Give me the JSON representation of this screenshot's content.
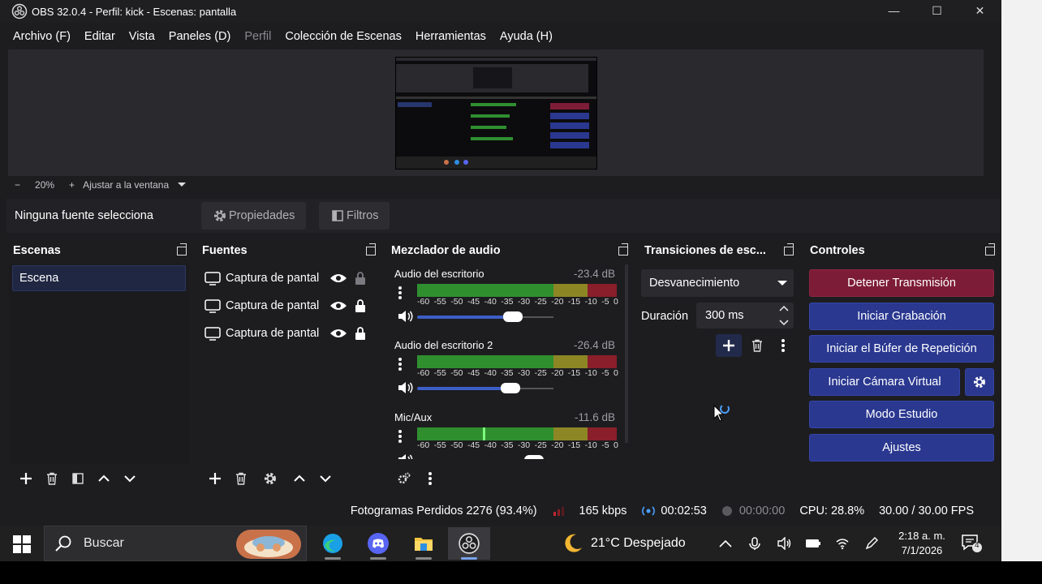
{
  "window": {
    "title": "OBS 32.0.4 - Perfil: kick - Escenas: pantalla",
    "minimize": "—",
    "maximize": "☐",
    "close": "✕"
  },
  "menu": [
    "Archivo (F)",
    "Editar",
    "Vista",
    "Paneles (D)",
    "Perfil",
    "Colección de Escenas",
    "Herramientas",
    "Ayuda (H)"
  ],
  "menu_disabled_index": 4,
  "zoom": {
    "minus": "−",
    "level": "20%",
    "plus": "+",
    "fit_label": "Ajustar a la ventana"
  },
  "context": {
    "no_source": "Ninguna fuente selecciona",
    "properties": "Propiedades",
    "filters": "Filtros"
  },
  "docks": {
    "scenes": {
      "title": "Escenas",
      "items": [
        "Escena"
      ]
    },
    "sources": {
      "title": "Fuentes",
      "items": [
        {
          "name": "Captura de pantal",
          "locked": false
        },
        {
          "name": "Captura de pantal",
          "locked": true
        },
        {
          "name": "Captura de pantal",
          "locked": true
        }
      ]
    },
    "mixer": {
      "title": "Mezclador de audio",
      "channels": [
        {
          "name": "Audio del escritorio",
          "db": "-23.4 dB",
          "volume_fraction": 0.74,
          "peak_fraction": null
        },
        {
          "name": "Audio del escritorio 2",
          "db": "-26.4 dB",
          "volume_fraction": 0.72,
          "peak_fraction": null
        },
        {
          "name": "Mic/Aux",
          "db": "-11.6 dB",
          "volume_fraction": 0.9,
          "peak_fraction": 0.33
        }
      ],
      "scale": [
        "-60",
        "-55",
        "-50",
        "-45",
        "-40",
        "-35",
        "-30",
        "-25",
        "-20",
        "-15",
        "-10",
        "-5",
        "0"
      ]
    },
    "transitions": {
      "title": "Transiciones de esc...",
      "selected": "Desvanecimiento",
      "duration_label": "Duración",
      "duration_value": "300 ms"
    },
    "controls": {
      "title": "Controles",
      "buttons": [
        "Detener Transmisión",
        "Iniciar Grabación",
        "Iniciar el Búfer de Repetición",
        "Iniciar Cámara Virtual",
        "Modo Estudio",
        "Ajustes"
      ]
    }
  },
  "status": {
    "dropped_frames": "Fotogramas Perdidos 2276 (93.4%)",
    "bitrate": "165 kbps",
    "stream_time": "00:02:53",
    "rec_time": "00:00:00",
    "cpu": "CPU: 28.8%",
    "fps": "30.00 / 30.00 FPS"
  },
  "taskbar": {
    "search_placeholder": "Buscar",
    "weather": "21°C  Despejado",
    "time": "2:18 a. m.",
    "date": "7/1/2026",
    "notifications": "4"
  },
  "colors": {
    "accent_blue": "#2a3890",
    "stop_red": "#7d1c36",
    "meter_green": "#2f8f2f",
    "meter_yellow": "#8d8624",
    "meter_red": "#8a1e2a"
  }
}
